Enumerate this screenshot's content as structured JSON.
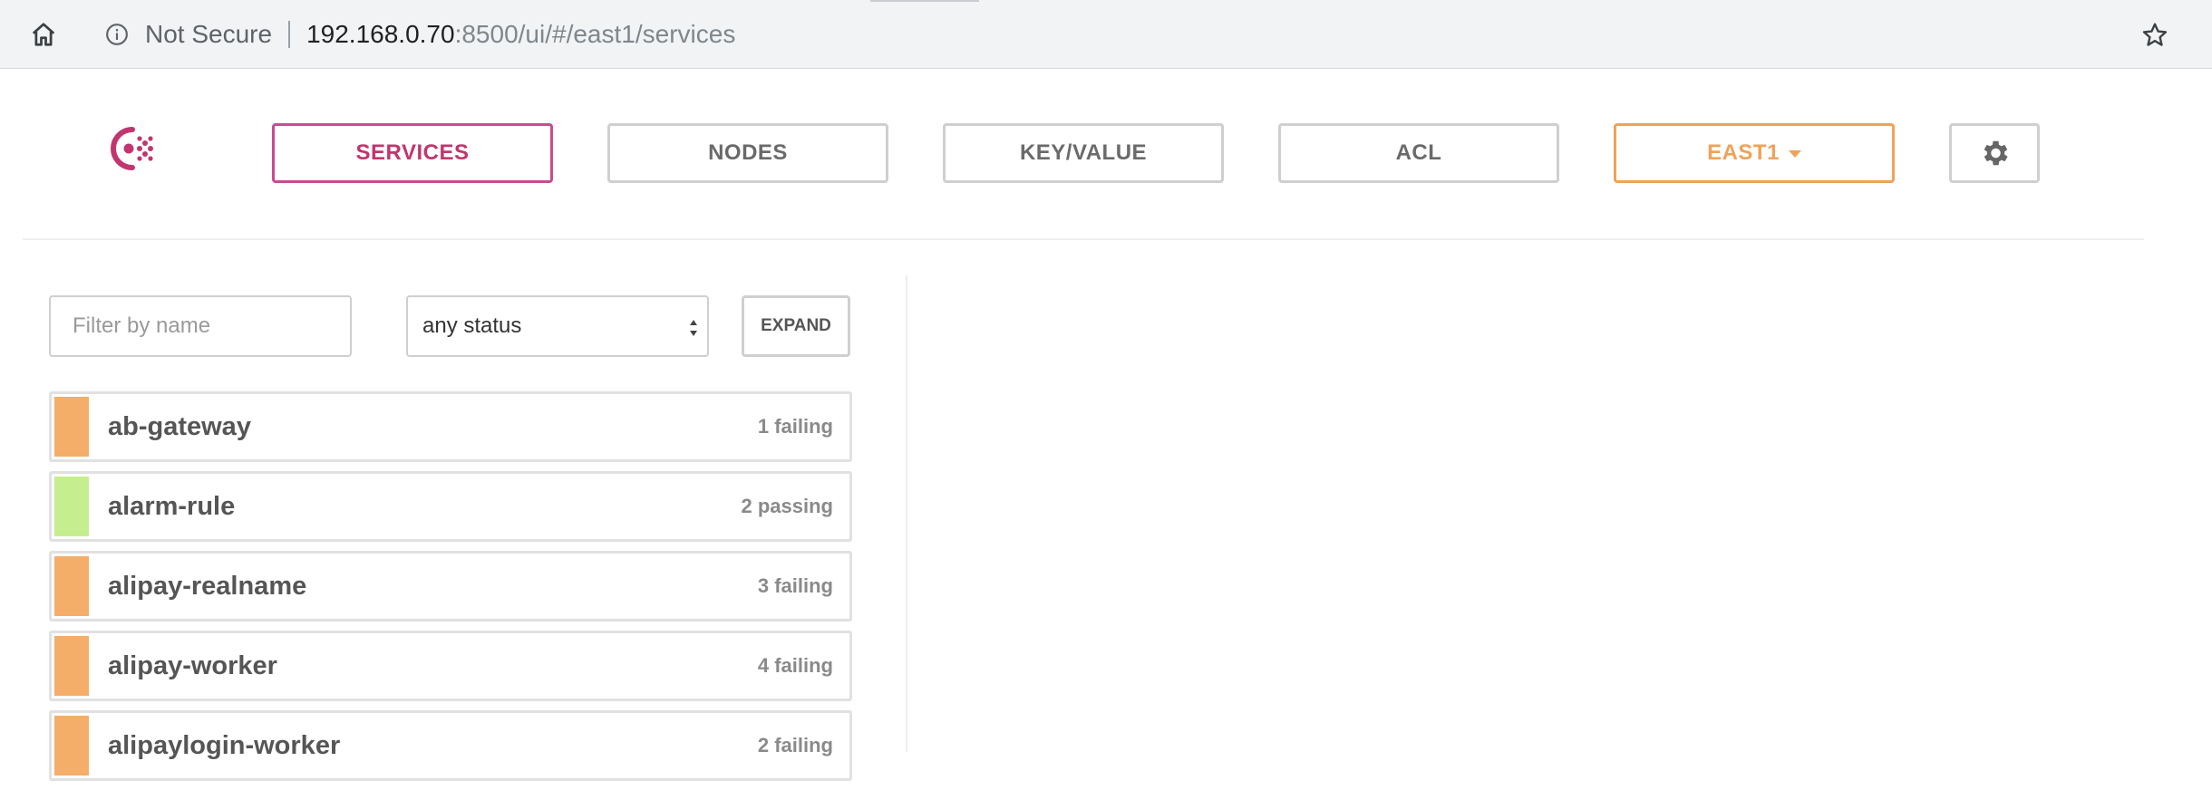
{
  "browser": {
    "security_label": "Not Secure",
    "url_host": "192.168.0.70",
    "url_rest": ":8500/ui/#/east1/services"
  },
  "nav": {
    "items": [
      {
        "label": "SERVICES",
        "active": true
      },
      {
        "label": "NODES",
        "active": false
      },
      {
        "label": "KEY/VALUE",
        "active": false
      },
      {
        "label": "ACL",
        "active": false
      }
    ],
    "datacenter": "EAST1"
  },
  "filters": {
    "name_placeholder": "Filter by name",
    "status_selected": "any status",
    "expand_label": "EXPAND"
  },
  "colors": {
    "accent": "#c1366f",
    "datacenter": "#f0a259",
    "failing": "#f5ad6a",
    "passing": "#c5ef8e"
  },
  "services": [
    {
      "name": "ab-gateway",
      "status": "1 failing",
      "state": "failing"
    },
    {
      "name": "alarm-rule",
      "status": "2 passing",
      "state": "passing"
    },
    {
      "name": "alipay-realname",
      "status": "3 failing",
      "state": "failing"
    },
    {
      "name": "alipay-worker",
      "status": "4 failing",
      "state": "failing"
    },
    {
      "name": "alipaylogin-worker",
      "status": "2 failing",
      "state": "failing"
    }
  ]
}
